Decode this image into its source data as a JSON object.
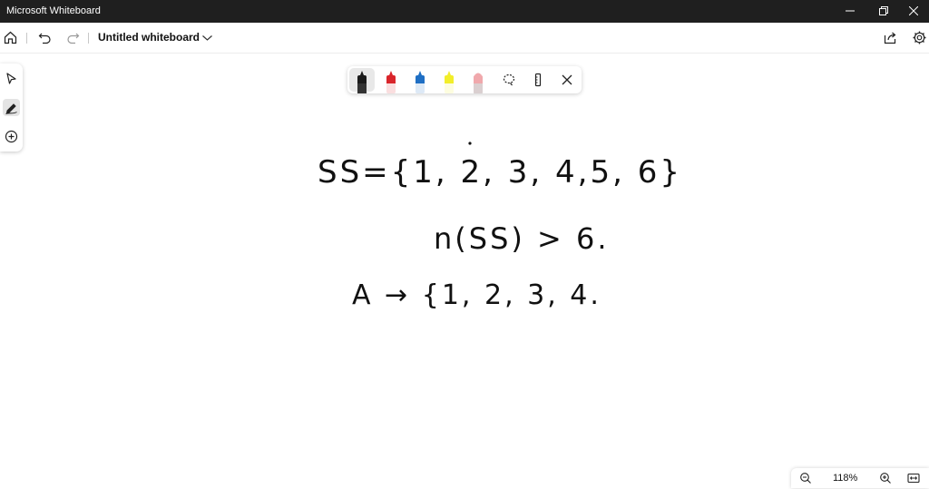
{
  "window": {
    "app_title": "Microsoft Whiteboard",
    "minimize_icon": "minimize-icon",
    "restore_icon": "restore-icon",
    "close_icon": "close-icon"
  },
  "toolbar": {
    "home_icon": "home-icon",
    "undo_icon": "undo-icon",
    "redo_icon": "redo-icon",
    "document_title": "Untitled whiteboard",
    "title_dropdown_icon": "chevron-down-icon",
    "share_icon": "share-icon",
    "settings_icon": "gear-icon"
  },
  "left_rail": {
    "items": [
      {
        "name": "select",
        "icon": "cursor-icon",
        "active": false
      },
      {
        "name": "ink",
        "icon": "pen-icon",
        "active": true
      },
      {
        "name": "add",
        "icon": "plus-circle-icon",
        "active": false
      }
    ]
  },
  "pen_tray": {
    "pens": [
      {
        "name": "black",
        "color": "#1a1a1a",
        "selected": true
      },
      {
        "name": "red",
        "color": "#d9252b",
        "selected": false
      },
      {
        "name": "blue",
        "color": "#1f6fc4",
        "selected": false
      },
      {
        "name": "yellow-highlighter",
        "color": "#f2ee2a",
        "selected": false
      },
      {
        "name": "eraser",
        "color": "#f0a8ac",
        "selected": false
      }
    ],
    "lasso_icon": "lasso-icon",
    "ruler_icon": "ruler-icon",
    "close_icon": "close-icon"
  },
  "canvas": {
    "ink_lines": [
      "SS={1, 2, 3, 4,5, 6}",
      "n(SS) > 6.",
      "A → {1, 2, 3, 4."
    ]
  },
  "zoom": {
    "zoom_out_icon": "zoom-out-icon",
    "level": "118%",
    "zoom_in_icon": "zoom-in-icon",
    "fit_icon": "fit-width-icon"
  }
}
